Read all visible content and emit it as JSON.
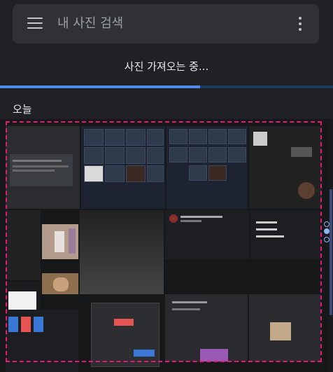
{
  "search": {
    "placeholder": "내 사진 검색"
  },
  "status": {
    "text": "사진 가져오는 중..."
  },
  "progress": {
    "fraction": 0.6
  },
  "section": {
    "title": "오늘"
  },
  "icons": {
    "menu": "menu-icon",
    "more": "more-vert-icon"
  },
  "colors": {
    "accent": "#4f8ae8",
    "selection": "#e6197b",
    "background": "#202124"
  }
}
